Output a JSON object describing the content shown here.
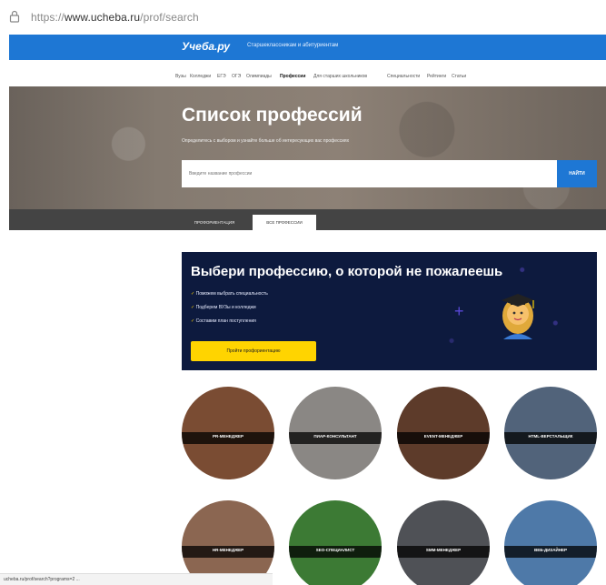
{
  "browser": {
    "url_prefix": "https://",
    "url_host": "www.ucheba.ru",
    "url_path": "/prof/search",
    "status_url": "ucheba.ru/prof/search?programs=2  ..."
  },
  "header": {
    "logo": "Учеба.ру",
    "subtitle": "Старшеклассникам и абитуриентам"
  },
  "nav": {
    "items": [
      "Вузы",
      "Колледжи",
      "ЕГЭ",
      "ОГЭ",
      "Олимпиады",
      "Профессии",
      "Для старших школьников",
      "Специальности",
      "Рейтинги",
      "Статьи"
    ],
    "active_index": 5
  },
  "hero": {
    "title": "Список профессий",
    "description": "Определитесь с выбором и узнайте больше об интересующих вас профессиях",
    "search_placeholder": "Введите название профессии",
    "search_button": "НАЙТИ",
    "tabs": [
      "ПРОФОРИЕНТАЦИЯ",
      "ВСЕ ПРОФЕССИИ"
    ],
    "active_tab": 1
  },
  "promo": {
    "title": "Выбери профессию, о которой не пожалеешь",
    "bullets": [
      "Поможем выбрать специальность",
      "Подберем ВУЗы и колледжи",
      "Составим план поступления"
    ],
    "button": "Пройти профориентацию"
  },
  "professions": [
    {
      "label": "PR-МЕНЕДЖЕР",
      "bg": "#7a4c33"
    },
    {
      "label": "ПИАР-КОНСУЛЬТАНТ",
      "bg": "#8a8784"
    },
    {
      "label": "EVENT-МЕНЕДЖЕР",
      "bg": "#5d3b2a"
    },
    {
      "label": "HTML-ВЕРСТАЛЬЩИК",
      "bg": "#51637a"
    },
    {
      "label": "HR-МЕНЕДЖЕР",
      "bg": "#8b6651"
    },
    {
      "label": "SEO-СПЕЦИАЛИСТ",
      "bg": "#3c7a34"
    },
    {
      "label": "SMM-МЕНЕДЖЕР",
      "bg": "#4f5156"
    },
    {
      "label": "ВЕБ-ДИЗАЙНЕР",
      "bg": "#4e79a8"
    }
  ]
}
